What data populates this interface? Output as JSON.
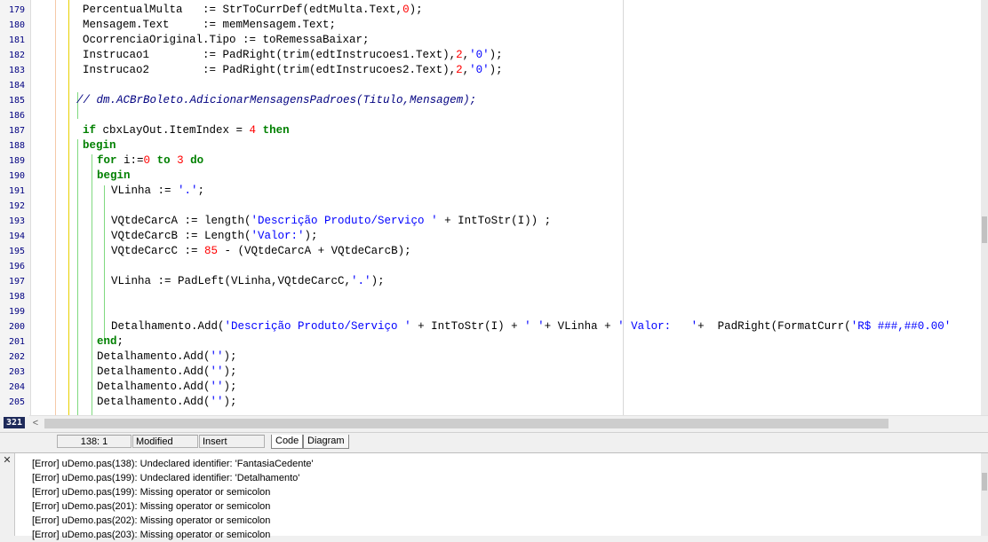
{
  "editor": {
    "line_numbers": [
      "179",
      "180",
      "181",
      "182",
      "183",
      "184",
      "185",
      "186",
      "187",
      "188",
      "189",
      "190",
      "191",
      "192",
      "193",
      "194",
      "195",
      "196",
      "197",
      "198",
      "199",
      "200",
      "201",
      "202",
      "203",
      "204",
      "205"
    ],
    "lines": [
      {
        "parts": [
          [
            "t",
            "PercentualMulta   := StrToCurrDef(edtMulta.Text,"
          ],
          [
            "n",
            "0"
          ],
          [
            "t",
            ");"
          ]
        ]
      },
      {
        "parts": [
          [
            "t",
            "Mensagem.Text     := memMensagem.Text;"
          ]
        ]
      },
      {
        "parts": [
          [
            "t",
            "OcorrenciaOriginal.Tipo := toRemessaBaixar;"
          ]
        ]
      },
      {
        "parts": [
          [
            "t",
            "Instrucao1        := PadRight(trim(edtInstrucoes1.Text),"
          ],
          [
            "n",
            "2"
          ],
          [
            "t",
            ","
          ],
          [
            "s",
            "'0'"
          ],
          [
            "t",
            ");"
          ]
        ]
      },
      {
        "parts": [
          [
            "t",
            "Instrucao2        := PadRight(trim(edtInstrucoes2.Text),"
          ],
          [
            "n",
            "2"
          ],
          [
            "t",
            ","
          ],
          [
            "s",
            "'0'"
          ],
          [
            "t",
            ");"
          ]
        ]
      },
      {
        "parts": []
      },
      {
        "parts": [
          [
            "c",
            "// dm.ACBrBoleto.AdicionarMensagensPadroes(Titulo,Mensagem);"
          ]
        ]
      },
      {
        "parts": []
      },
      {
        "parts": [
          [
            "k",
            "if"
          ],
          [
            "t",
            " cbxLayOut.ItemIndex = "
          ],
          [
            "n",
            "4"
          ],
          [
            "t",
            " "
          ],
          [
            "k",
            "then"
          ]
        ]
      },
      {
        "parts": [
          [
            "k",
            "begin"
          ]
        ]
      },
      {
        "parts": [
          [
            "k",
            "for"
          ],
          [
            "t",
            " i:="
          ],
          [
            "n",
            "0"
          ],
          [
            "t",
            " "
          ],
          [
            "k",
            "to"
          ],
          [
            "t",
            " "
          ],
          [
            "n",
            "3"
          ],
          [
            "t",
            " "
          ],
          [
            "k",
            "do"
          ]
        ]
      },
      {
        "parts": [
          [
            "k",
            "begin"
          ]
        ]
      },
      {
        "parts": [
          [
            "t",
            "VLinha := "
          ],
          [
            "s",
            "'.'"
          ],
          [
            "t",
            ";"
          ]
        ]
      },
      {
        "parts": []
      },
      {
        "parts": [
          [
            "t",
            "VQtdeCarcA := length("
          ],
          [
            "s",
            "'Descrição Produto/Serviço '"
          ],
          [
            "t",
            " + IntToStr(I)) ;"
          ]
        ]
      },
      {
        "parts": [
          [
            "t",
            "VQtdeCarcB := Length("
          ],
          [
            "s",
            "'Valor:'"
          ],
          [
            "t",
            ");"
          ]
        ]
      },
      {
        "parts": [
          [
            "t",
            "VQtdeCarcC := "
          ],
          [
            "n",
            "85"
          ],
          [
            "t",
            " - (VQtdeCarcA + VQtdeCarcB);"
          ]
        ]
      },
      {
        "parts": []
      },
      {
        "parts": [
          [
            "t",
            "VLinha := PadLeft(VLinha,VQtdeCarcC,"
          ],
          [
            "s",
            "'.'"
          ],
          [
            "t",
            ");"
          ]
        ]
      },
      {
        "parts": []
      },
      {
        "parts": []
      },
      {
        "parts": [
          [
            "t",
            "Detalhamento.Add("
          ],
          [
            "s",
            "'Descrição Produto/Serviço '"
          ],
          [
            "t",
            " + IntToStr(I) + "
          ],
          [
            "s",
            "' '"
          ],
          [
            "t",
            "+ VLinha + "
          ],
          [
            "s",
            "' Valor:   '"
          ],
          [
            "t",
            "+  PadRight(FormatCurr("
          ],
          [
            "s",
            "'R$ ###,##0.00'"
          ]
        ]
      },
      {
        "parts": [
          [
            "k",
            "end"
          ],
          [
            "t",
            ";"
          ]
        ]
      },
      {
        "parts": [
          [
            "t",
            "Detalhamento.Add("
          ],
          [
            "s",
            "''"
          ],
          [
            "t",
            ");"
          ]
        ]
      },
      {
        "parts": [
          [
            "t",
            "Detalhamento.Add("
          ],
          [
            "s",
            "''"
          ],
          [
            "t",
            ");"
          ]
        ]
      },
      {
        "parts": [
          [
            "t",
            "Detalhamento.Add("
          ],
          [
            "s",
            "''"
          ],
          [
            "t",
            ");"
          ]
        ]
      },
      {
        "parts": [
          [
            "t",
            "Detalhamento.Add("
          ],
          [
            "s",
            "''"
          ],
          [
            "t",
            ");"
          ]
        ]
      }
    ],
    "corner_badge": "321",
    "scroll_left_arrow": "<"
  },
  "statusbar": {
    "position": "138:  1",
    "modified": "Modified",
    "insert": "Insert",
    "tab_code": "Code",
    "tab_diagram": "Diagram"
  },
  "messages": {
    "close_symbol": "✕",
    "items": [
      "[Error] uDemo.pas(138): Undeclared identifier: 'FantasiaCedente'",
      "[Error] uDemo.pas(199): Undeclared identifier: 'Detalhamento'",
      "[Error] uDemo.pas(199): Missing operator or semicolon",
      "[Error] uDemo.pas(201): Missing operator or semicolon",
      "[Error] uDemo.pas(202): Missing operator or semicolon",
      "[Error] uDemo.pas(203): Missing operator or semicolon"
    ]
  },
  "colors": {
    "keyword": "#008000",
    "string": "#0000ff",
    "number": "#ff0000",
    "comment": "#000080"
  }
}
